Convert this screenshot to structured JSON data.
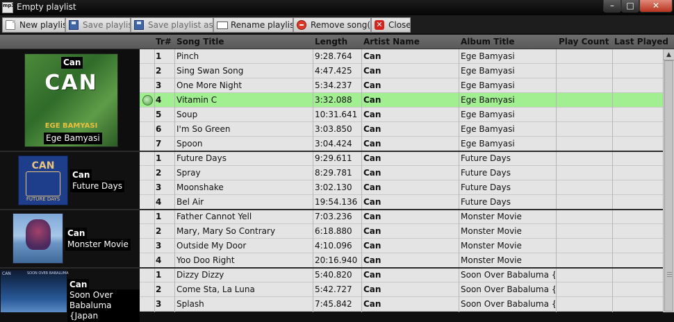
{
  "window": {
    "title": "Empty playlist",
    "icon_text": "mp3"
  },
  "toolbar": {
    "new_playlist": "New playlist",
    "save_playlist": "Save playlist",
    "save_playlist_as": "Save playlist as...",
    "rename_playlist": "Rename playlist",
    "remove_songs": "Remove song(s)",
    "close": "Close"
  },
  "columns": {
    "tr": "Tr#",
    "title": "Song Title",
    "length": "Length",
    "artist": "Artist Name",
    "album": "Album Title",
    "play_count": "Play Count",
    "last_played": "Last Played"
  },
  "groups": [
    {
      "artist": "Can",
      "album": "Ege Bamyasi",
      "cover_text": "CAN",
      "cover_sub": "EGE BAMYASI"
    },
    {
      "artist": "Can",
      "album": "Future Days",
      "cover_text": "CAN",
      "cover_sub": "FUTURE DAYS"
    },
    {
      "artist": "Can",
      "album": "Monster Movie"
    },
    {
      "artist": "Can",
      "album": "Soon Over Babaluma {Japan",
      "cover_text": "CAN",
      "cover_sub": "SOON OVER BABALUMA"
    }
  ],
  "rows": [
    {
      "tr": "1",
      "title": "Pinch",
      "length": "9:28.764",
      "artist": "Can",
      "album": "Ege Bamyasi",
      "play_count": "",
      "last_played": ""
    },
    {
      "tr": "2",
      "title": "Sing Swan Song",
      "length": "4:47.425",
      "artist": "Can",
      "album": "Ege Bamyasi",
      "play_count": "",
      "last_played": ""
    },
    {
      "tr": "3",
      "title": "One More Night",
      "length": "5:34.237",
      "artist": "Can",
      "album": "Ege Bamyasi",
      "play_count": "",
      "last_played": ""
    },
    {
      "tr": "4",
      "title": "Vitamin C",
      "length": "3:32.088",
      "artist": "Can",
      "album": "Ege Bamyasi",
      "play_count": "",
      "last_played": "",
      "playing": true
    },
    {
      "tr": "5",
      "title": "Soup",
      "length": "10:31.641",
      "artist": "Can",
      "album": "Ege Bamyasi",
      "play_count": "",
      "last_played": ""
    },
    {
      "tr": "6",
      "title": "I'm So Green",
      "length": "3:03.850",
      "artist": "Can",
      "album": "Ege Bamyasi",
      "play_count": "",
      "last_played": ""
    },
    {
      "tr": "7",
      "title": "Spoon",
      "length": "3:04.424",
      "artist": "Can",
      "album": "Ege Bamyasi",
      "play_count": "",
      "last_played": ""
    },
    {
      "tr": "1",
      "title": "Future Days",
      "length": "9:29.611",
      "artist": "Can",
      "album": "Future Days",
      "play_count": "",
      "last_played": ""
    },
    {
      "tr": "2",
      "title": "Spray",
      "length": "8:29.781",
      "artist": "Can",
      "album": "Future Days",
      "play_count": "",
      "last_played": ""
    },
    {
      "tr": "3",
      "title": "Moonshake",
      "length": "3:02.130",
      "artist": "Can",
      "album": "Future Days",
      "play_count": "",
      "last_played": ""
    },
    {
      "tr": "4",
      "title": "Bel Air",
      "length": "19:54.136",
      "artist": "Can",
      "album": "Future Days",
      "play_count": "",
      "last_played": ""
    },
    {
      "tr": "1",
      "title": "Father Cannot Yell",
      "length": "7:03.236",
      "artist": "Can",
      "album": "Monster Movie",
      "play_count": "",
      "last_played": ""
    },
    {
      "tr": "2",
      "title": "Mary, Mary So Contrary",
      "length": "6:18.880",
      "artist": "Can",
      "album": "Monster Movie",
      "play_count": "",
      "last_played": ""
    },
    {
      "tr": "3",
      "title": "Outside My Door",
      "length": "4:10.096",
      "artist": "Can",
      "album": "Monster Movie",
      "play_count": "",
      "last_played": ""
    },
    {
      "tr": "4",
      "title": "Yoo Doo Right",
      "length": "20:16.940",
      "artist": "Can",
      "album": "Monster Movie",
      "play_count": "",
      "last_played": ""
    },
    {
      "tr": "1",
      "title": "Dizzy Dizzy",
      "length": "5:40.820",
      "artist": "Can",
      "album": "Soon Over Babaluma {J",
      "play_count": "",
      "last_played": ""
    },
    {
      "tr": "2",
      "title": "Come Sta, La Luna",
      "length": "5:42.727",
      "artist": "Can",
      "album": "Soon Over Babaluma {J",
      "play_count": "",
      "last_played": ""
    },
    {
      "tr": "3",
      "title": "Splash",
      "length": "7:45.842",
      "artist": "Can",
      "album": "Soon Over Babaluma {J",
      "play_count": "",
      "last_played": ""
    }
  ],
  "colors": {
    "playing_row": "#a2ef92",
    "row": "#e4e4e4",
    "header": "#646464",
    "background": "#0f0f0f"
  }
}
